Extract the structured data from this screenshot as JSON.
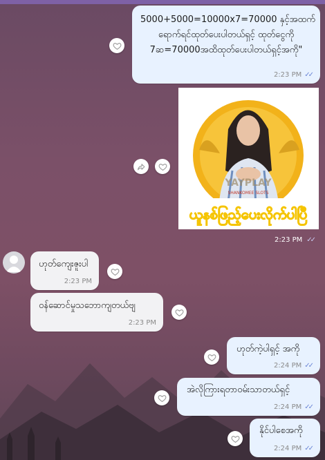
{
  "colors": {
    "accent": "#7e61a6",
    "outgoing_bubble": "#e8f2ff",
    "incoming_bubble": "#f2f2f4",
    "read_ticks": "#6c86d6"
  },
  "messages": [
    {
      "direction": "outgoing",
      "lines": [
        "5000+5000=10000x7=70000 နှင့်အထက်",
        "ရောက်ရင်ထုတ်ပေးပါတယ်ရှင့် ထုတ်ငွေကို",
        "7ဆ=70000အထိထုတ်ပေးပါတယ်ရှင့်အကို\""
      ],
      "time": "2:23 PM",
      "status": "read"
    },
    {
      "direction": "outgoing",
      "type": "image",
      "image_text": {
        "brand": "YAYPLAY",
        "sub": "SHANKOMEE SLOTS",
        "caption": "ယူနစ်ဖြည့်ပေးလိုက်ပါပြီ"
      },
      "time": "2:23 PM",
      "status": "read"
    },
    {
      "direction": "incoming",
      "text": "ဟုတ်ကျေးဇူးပါ",
      "time": "2:23 PM"
    },
    {
      "direction": "incoming",
      "text": "ဝန်ဆောင်မှုသဘောကျတယ်ဗျ",
      "time": "2:23 PM"
    },
    {
      "direction": "outgoing",
      "text": "ဟုတ်ကဲ့ပါရှင့် အကို",
      "time": "2:24 PM",
      "status": "read"
    },
    {
      "direction": "outgoing",
      "text": "အဲလိုကြားရတာဝမ်းသာတယ်ရှင့်",
      "time": "2:24 PM",
      "status": "read"
    },
    {
      "direction": "outgoing",
      "text": "နိုင်ပါစေအကို",
      "time": "2:24 PM",
      "status": "read"
    }
  ],
  "icons": {
    "reaction": "heart-outline-icon",
    "forward": "forward-icon",
    "read_status": "double-check-icon"
  }
}
